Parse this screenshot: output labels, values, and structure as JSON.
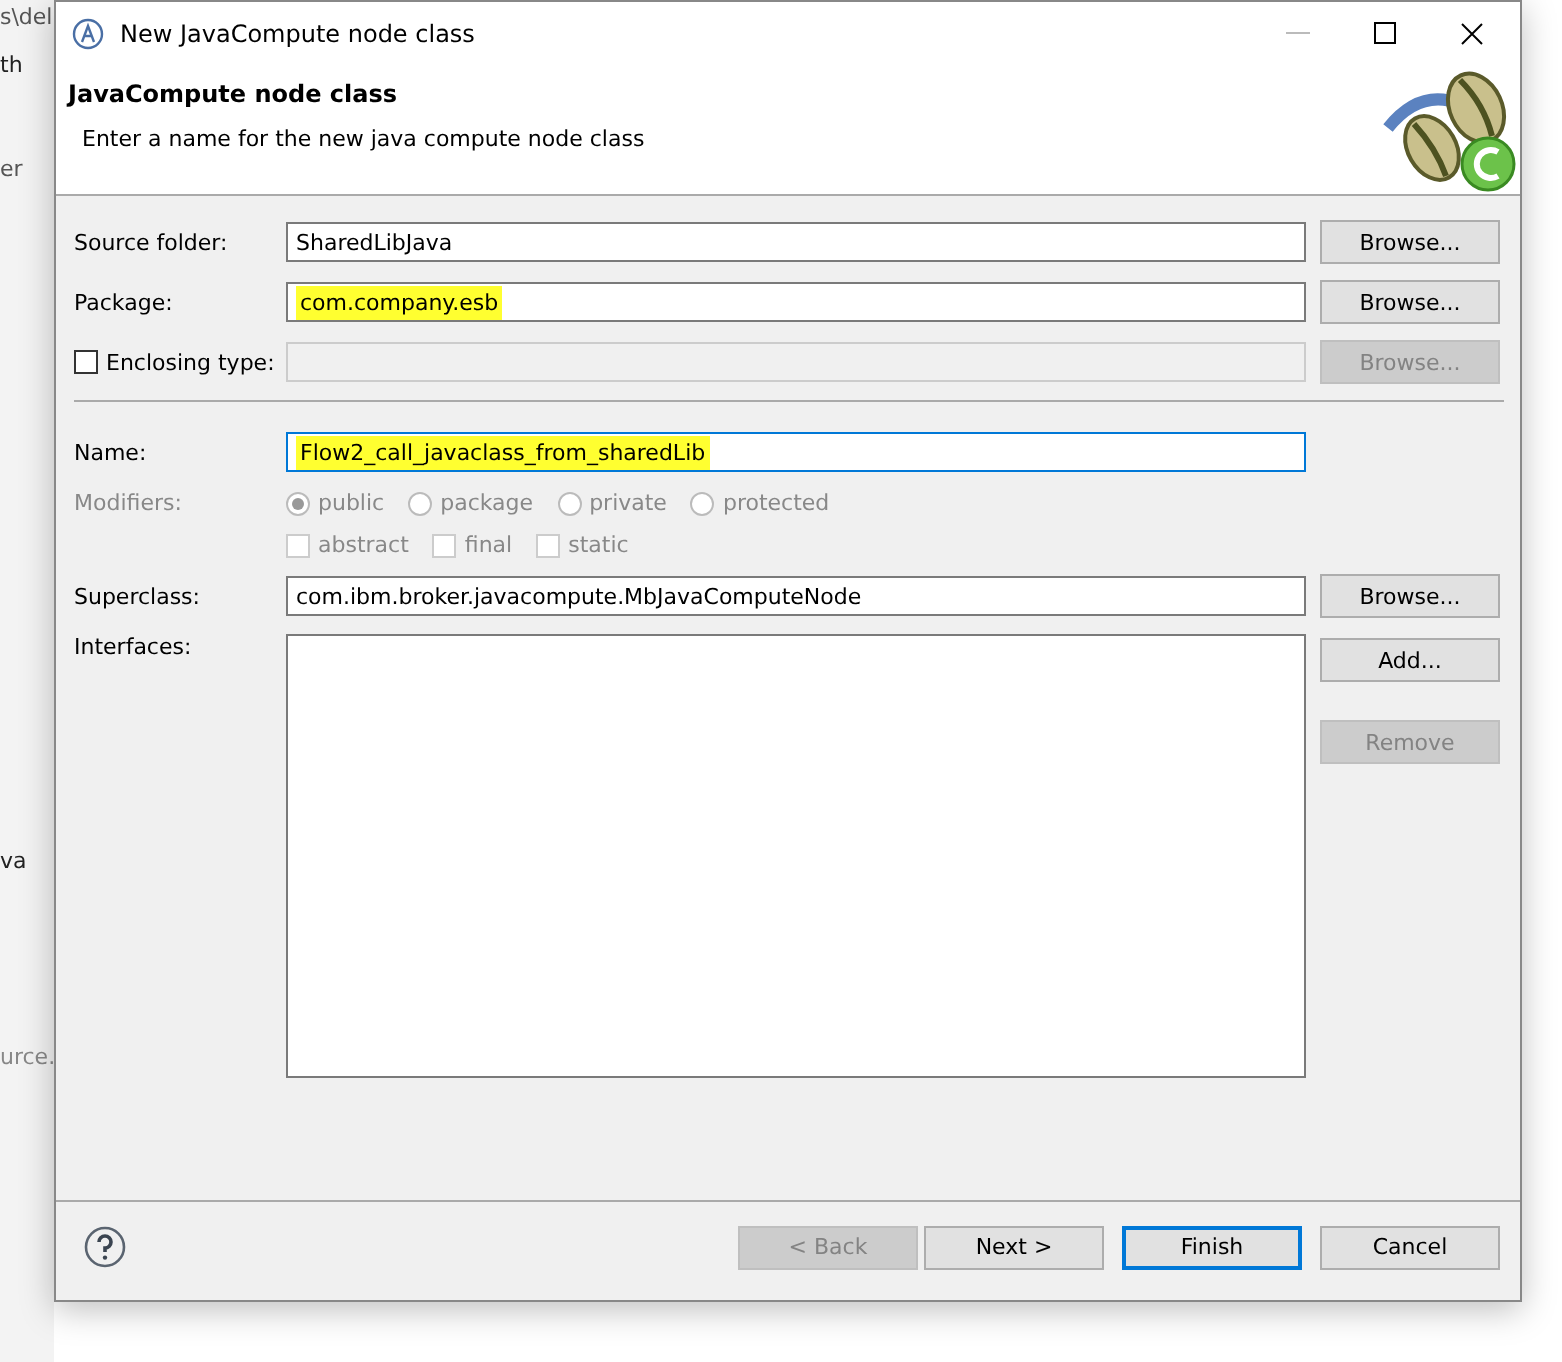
{
  "background": {
    "fragments": [
      "s\\del",
      "th",
      "er",
      "va",
      "urce."
    ]
  },
  "window": {
    "title": "New JavaCompute node class"
  },
  "header": {
    "title": "JavaCompute node class",
    "subtitle": "Enter a name for the new java compute node class"
  },
  "fields": [
    {
      "kind": "text",
      "label": "Source folder:",
      "value": "SharedLibJava",
      "highlighted": false,
      "focused": false,
      "button": {
        "label": "Browse...",
        "disabled": false
      }
    },
    {
      "kind": "text",
      "label": "Package:",
      "value": "com.company.esb",
      "highlighted": true,
      "focused": false,
      "button": {
        "label": "Browse...",
        "disabled": false
      }
    },
    {
      "kind": "check",
      "label": "Enclosing type:",
      "checked": false,
      "disabled": true,
      "button": {
        "label": "Browse...",
        "disabled": true
      }
    },
    {
      "kind": "separator"
    },
    {
      "kind": "text",
      "label": "Name:",
      "value": "Flow2_call_javaclass_from_sharedLib",
      "highlighted": true,
      "focused": true
    },
    {
      "kind": "modifiers",
      "label": "Modifiers:",
      "disabled": true,
      "radios": [
        {
          "label": "public",
          "selected": true
        },
        {
          "label": "package",
          "selected": false
        },
        {
          "label": "private",
          "selected": false
        },
        {
          "label": "protected",
          "selected": false
        }
      ],
      "checks": [
        {
          "label": "abstract",
          "checked": false
        },
        {
          "label": "final",
          "checked": false
        },
        {
          "label": "static",
          "checked": false
        }
      ]
    },
    {
      "kind": "text",
      "label": "Superclass:",
      "value": "com.ibm.broker.javacompute.MbJavaComputeNode",
      "highlighted": false,
      "focused": false,
      "button": {
        "label": "Browse...",
        "disabled": false
      }
    },
    {
      "kind": "list",
      "label": "Interfaces:",
      "buttons": [
        {
          "label": "Add...",
          "disabled": false
        },
        {
          "label": "Remove",
          "disabled": true
        }
      ]
    }
  ],
  "footer": {
    "buttons": [
      {
        "label": "< Back",
        "disabled": true,
        "focused": false
      },
      {
        "label": "Next >",
        "disabled": false,
        "focused": false
      },
      {
        "label": "Finish",
        "disabled": false,
        "focused": true
      },
      {
        "label": "Cancel",
        "disabled": false,
        "focused": false
      }
    ]
  }
}
